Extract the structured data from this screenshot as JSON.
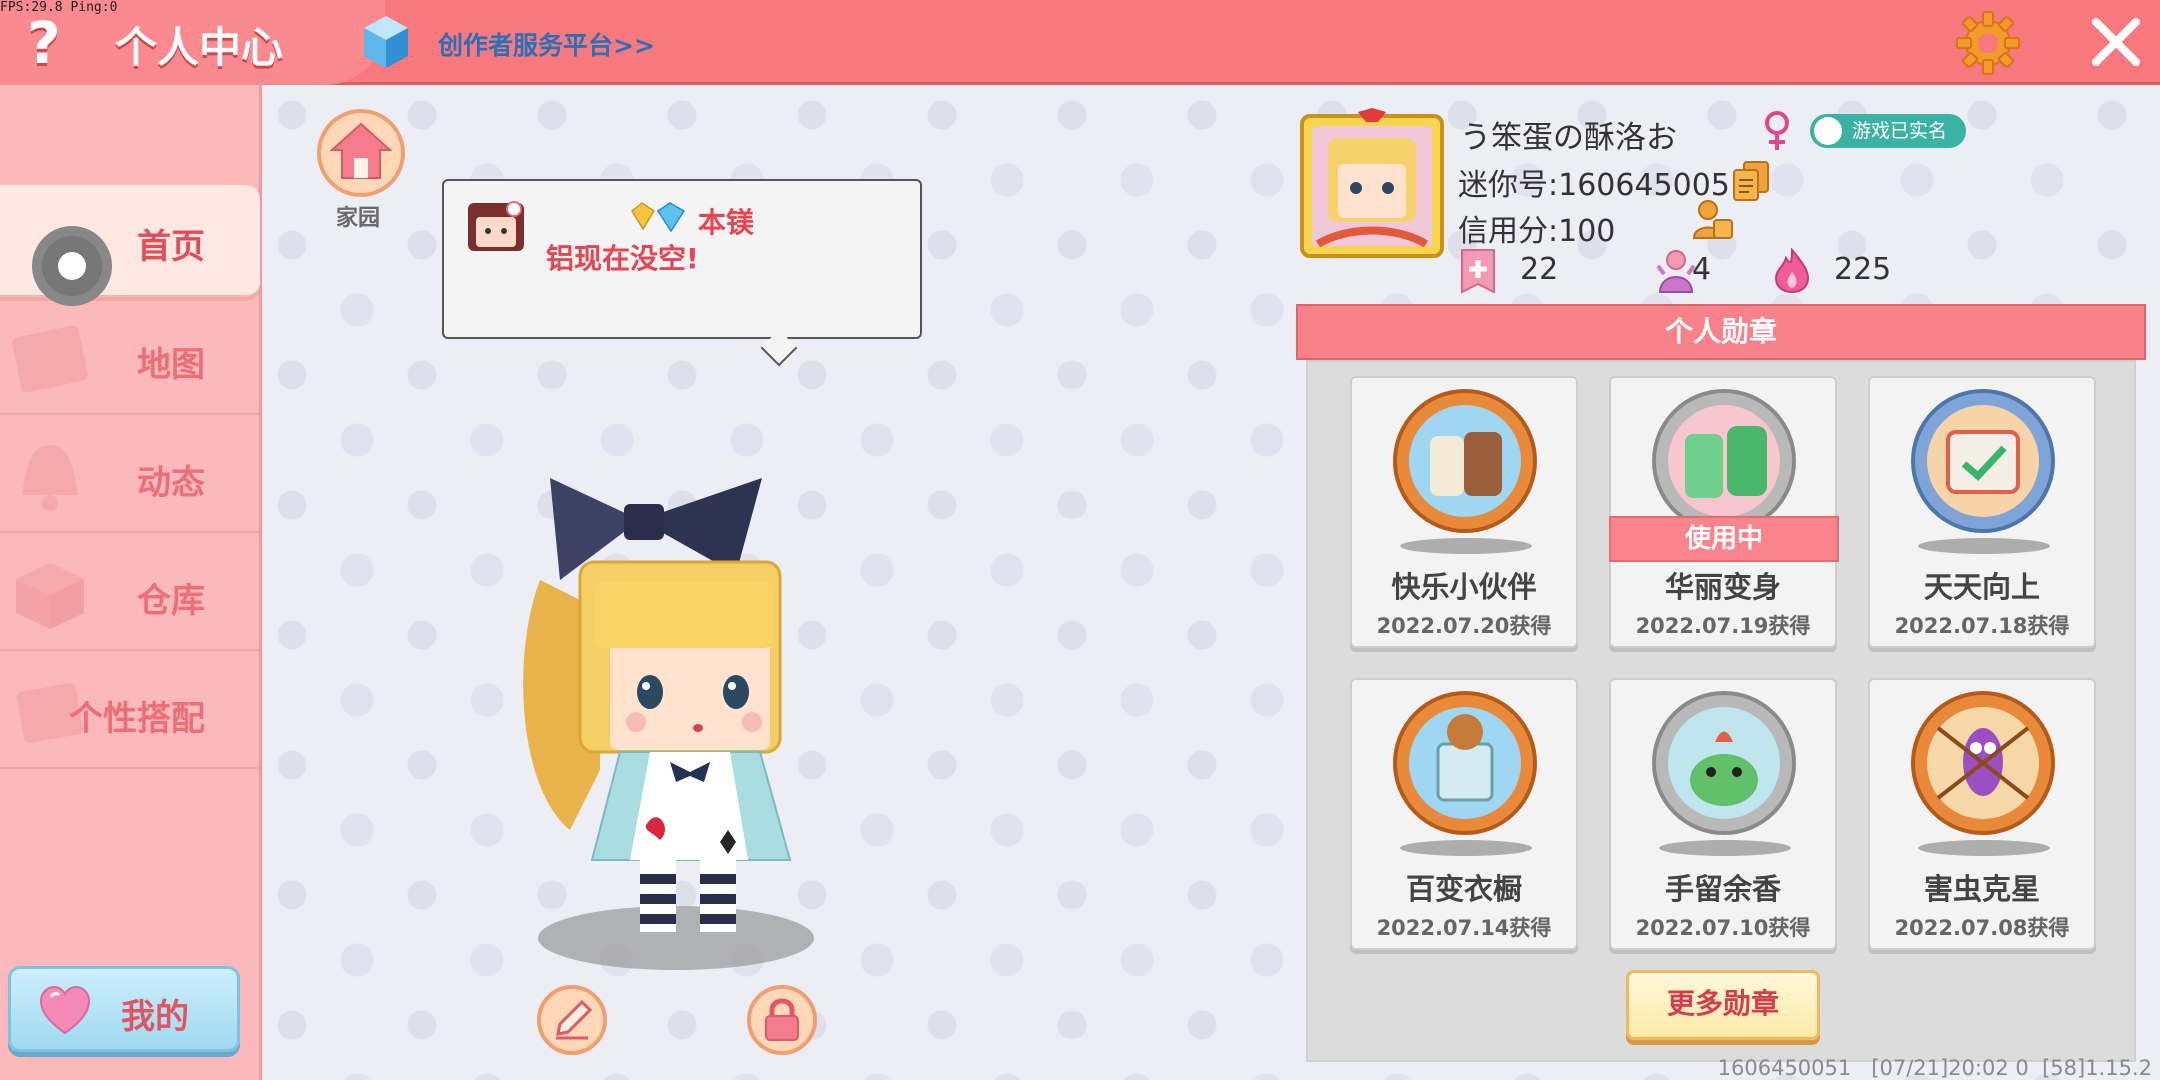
{
  "debug": {
    "fps": "FPS:29.8 Ping:0"
  },
  "header": {
    "help": "?",
    "title": "个人中心",
    "creator_link": "创作者服务平台>>"
  },
  "sidebar": {
    "items": [
      {
        "label": "首页",
        "active": true
      },
      {
        "label": "地图",
        "active": false
      },
      {
        "label": "动态",
        "active": false
      },
      {
        "label": "仓库",
        "active": false
      },
      {
        "label": "个性搭配",
        "active": false
      }
    ],
    "mine_label": "我的"
  },
  "home": {
    "label": "家园"
  },
  "bubble": {
    "line1": "本镁",
    "line2": "铝现在没空!"
  },
  "profile": {
    "nickname": "う笨蛋の酥洛お",
    "realname_badge": "游戏已实名",
    "mini_id": "迷你号:1606450051",
    "credit": "信用分:100",
    "stats": {
      "plus": "22",
      "fans": "4",
      "heat": "225"
    }
  },
  "medals": {
    "header": "个人勋章",
    "items": [
      {
        "name": "快乐小伙伴",
        "date": "2022.07.20获得",
        "in_use": false
      },
      {
        "name": "华丽变身",
        "date": "2022.07.19获得",
        "in_use": true,
        "in_use_label": "使用中"
      },
      {
        "name": "天天向上",
        "date": "2022.07.18获得",
        "in_use": false
      },
      {
        "name": "百变衣橱",
        "date": "2022.07.14获得",
        "in_use": false
      },
      {
        "name": "手留余香",
        "date": "2022.07.10获得",
        "in_use": false
      },
      {
        "name": "害虫克星",
        "date": "2022.07.08获得",
        "in_use": false
      }
    ],
    "more_button": "更多勋章"
  },
  "footer": {
    "info": "1606450051   [07/21]20:02 0  [58]1.15.2"
  },
  "colors": {
    "accent": "#f7787d",
    "sidebar": "#fbb9bc",
    "text_red": "#e94450"
  }
}
